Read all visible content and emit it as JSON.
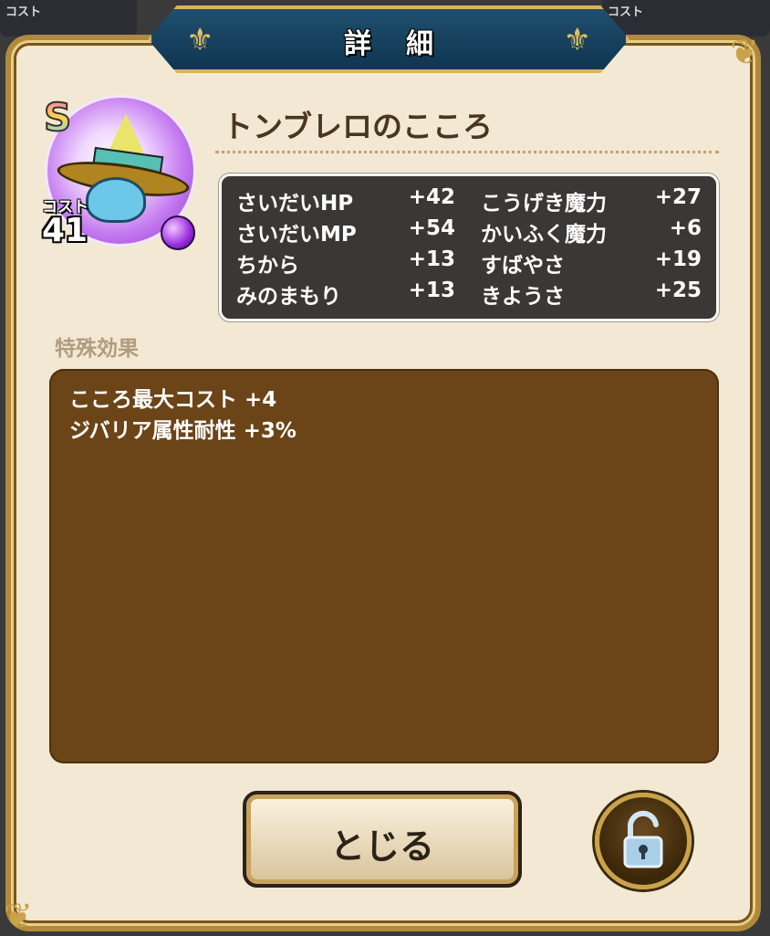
{
  "background": {
    "left_card_label": "コスト",
    "right_card_label": "コスト"
  },
  "dialog": {
    "title": "詳細"
  },
  "monster": {
    "rank": "S",
    "cost_label": "コスト",
    "cost": "41",
    "name": "トンブレロのこころ",
    "icons": [
      "sombrero-monster-icon",
      "purple-gem-icon"
    ]
  },
  "stats": [
    {
      "label": "さいだいHP",
      "value": "+42"
    },
    {
      "label": "こうげき魔力",
      "value": "+27"
    },
    {
      "label": "さいだいMP",
      "value": "+54"
    },
    {
      "label": "かいふく魔力",
      "value": "+6"
    },
    {
      "label": "ちから",
      "value": "+13"
    },
    {
      "label": "すばやさ",
      "value": "+19"
    },
    {
      "label": "みのまもり",
      "value": "+13"
    },
    {
      "label": "きようさ",
      "value": "+25"
    }
  ],
  "special": {
    "label": "特殊効果",
    "effects": [
      "こころ最大コスト +4",
      "ジバリア属性耐性 +3%"
    ]
  },
  "buttons": {
    "close_label": "とじる",
    "lock_icon": "unlock-icon"
  },
  "colors": {
    "panel": "#f2e8d3",
    "banner": "#1f4f6e",
    "gold": "#caa24a",
    "effects_bg": "#6b4418",
    "stats_bg": "#3a3837"
  }
}
